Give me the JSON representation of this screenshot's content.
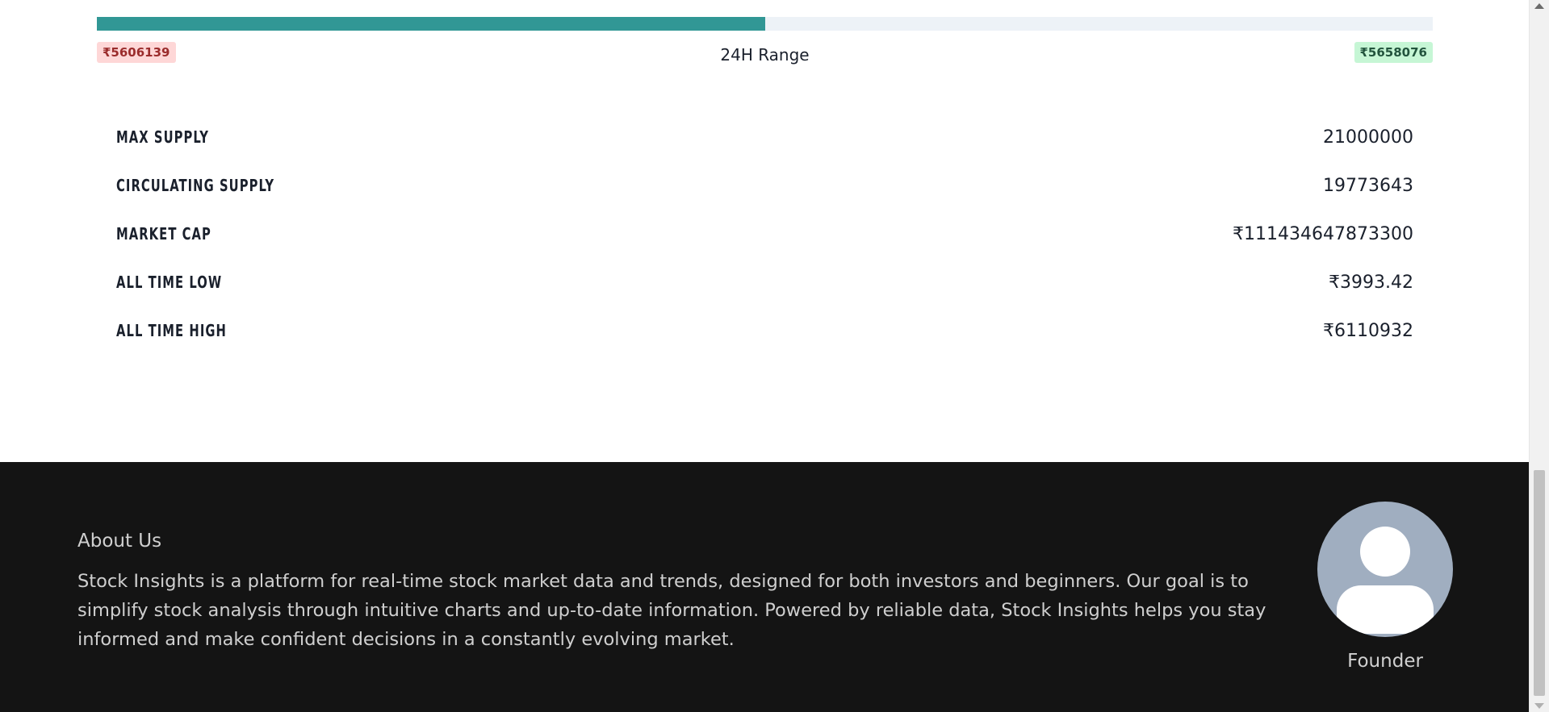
{
  "range": {
    "low": "₹5606139",
    "high": "₹5658076",
    "label": "24H Range",
    "fill_fraction": 0.5,
    "fill_color": "#319795"
  },
  "stats": [
    {
      "label": "MAX SUPPLY",
      "value": "21000000"
    },
    {
      "label": "CIRCULATING SUPPLY",
      "value": "19773643"
    },
    {
      "label": "MARKET CAP",
      "value": "₹111434647873300"
    },
    {
      "label": "ALL TIME LOW",
      "value": "₹3993.42"
    },
    {
      "label": "ALL TIME HIGH",
      "value": "₹6110932"
    }
  ],
  "footer": {
    "about_title": "About Us",
    "about_text": "Stock Insights is a platform for real-time stock market data and trends, designed for both investors and beginners. Our goal is to simplify stock analysis through intuitive charts and up-to-date information. Powered by reliable data, Stock Insights helps you stay informed and make confident decisions in a constantly evolving market.",
    "avatar_icon": "user-avatar-icon",
    "founder_label": "Founder"
  }
}
